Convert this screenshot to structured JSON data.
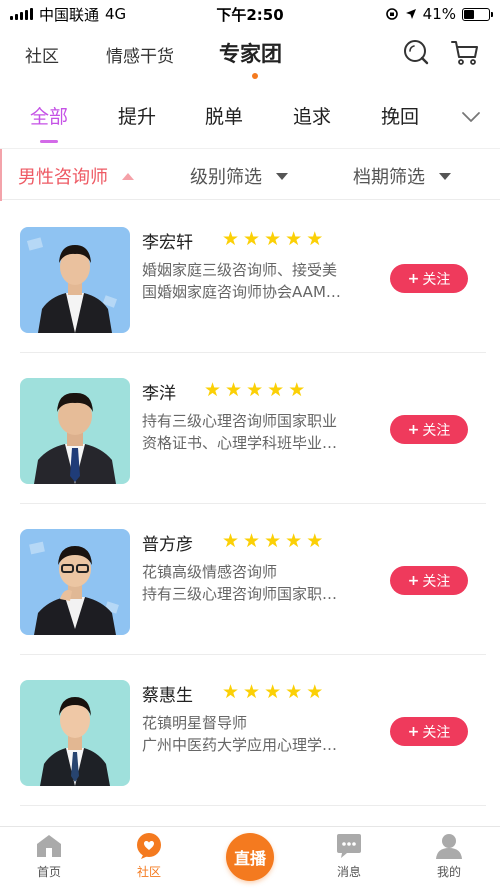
{
  "status_bar": {
    "carrier": "中国联通",
    "network": "4G",
    "time": "下午2:50",
    "battery_text": "41%",
    "battery_level": 0.41
  },
  "top_nav": {
    "tabs": [
      {
        "label": "社区",
        "active": false
      },
      {
        "label": "情感干货",
        "active": false
      },
      {
        "label": "专家团",
        "active": true
      }
    ],
    "icons": [
      "search-icon",
      "cart-icon"
    ]
  },
  "categories": {
    "tabs": [
      "全部",
      "提升",
      "脱单",
      "追求",
      "挽回"
    ],
    "active_index": 0,
    "more_icon": "chevron-down-icon"
  },
  "filters": [
    {
      "label": "男性咨询师",
      "active": true
    },
    {
      "label": "级别筛选",
      "active": false
    },
    {
      "label": "档期筛选",
      "active": false
    }
  ],
  "counselors": [
    {
      "name": "李宏轩",
      "stars": 5,
      "desc1": "婚姻家庭三级咨询师、接受美",
      "desc2": "国婚姻家庭咨询师协会AAM…",
      "follow_label": "关注",
      "avatar_bg": "#8fc3f2"
    },
    {
      "name": "李洋",
      "stars": 5,
      "desc1": "持有三级心理咨询师国家职业",
      "desc2": "资格证书、心理学科班毕业…",
      "follow_label": "关注",
      "avatar_bg": "#9fe0dc"
    },
    {
      "name": "普方彦",
      "stars": 5,
      "desc1": "花镇高级情感咨询师",
      "desc2": "持有三级心理咨询师国家职…",
      "follow_label": "关注",
      "avatar_bg": "#8fc3f2"
    },
    {
      "name": "蔡惠生",
      "stars": 5,
      "desc1": "花镇明星督导师",
      "desc2": "广州中医药大学应用心理学…",
      "follow_label": "关注",
      "avatar_bg": "#9fe0dc"
    }
  ],
  "tab_bar": {
    "items": [
      {
        "label": "首页",
        "icon": "home-icon",
        "active": false
      },
      {
        "label": "社区",
        "icon": "heart-bubble-icon",
        "active": true
      },
      {
        "label": "消息",
        "icon": "message-icon",
        "active": false
      },
      {
        "label": "我的",
        "icon": "profile-icon",
        "active": false
      }
    ],
    "live_label": "直播"
  },
  "colors": {
    "accent_orange": "#f47a1f",
    "category_active": "#c552e6",
    "filter_active": "#ee5a64",
    "follow_button": "#ef3a5c",
    "star": "#fbd006"
  }
}
